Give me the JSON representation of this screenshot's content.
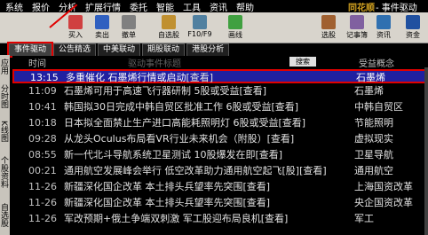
{
  "menu": [
    "系统",
    "报价",
    "分析",
    "扩展行情",
    "委托",
    "智能",
    "工具",
    "资讯",
    "帮助"
  ],
  "brand_logo": "同花顺",
  "window_title": "- 事件驱动",
  "toolbar": {
    "buttons": [
      "买入",
      "卖出",
      "撤单",
      "自选股",
      "F10/F9",
      "画线",
      "选股",
      "记事簿",
      "资讯"
    ],
    "right_label": "资金"
  },
  "tabs": [
    {
      "label": "事件驱动",
      "active": true
    },
    {
      "label": "公告精选",
      "active": false
    },
    {
      "label": "中美联动",
      "active": false
    },
    {
      "label": "期股联动",
      "active": false
    },
    {
      "label": "港股分析",
      "active": false
    }
  ],
  "left_sidebar": [
    "应用",
    "分时图",
    "K线图",
    "个股资料",
    "自选股"
  ],
  "header": {
    "time_col": "时间",
    "subtitle": "驱动事件标题",
    "search_btn": "搜索",
    "concept_col": "受益概念"
  },
  "rows": [
    {
      "time": "13:15",
      "title": "多重催化 石墨烯行情或启动",
      "view": "[查看]",
      "concept": "石墨烯",
      "selected": true
    },
    {
      "time": "11:09",
      "title": "石墨烯可用于高速飞行器研制 5股或受益",
      "view": "[查看]",
      "concept": "石墨烯",
      "selected": false
    },
    {
      "time": "10:41",
      "title": "韩国拟30日完成中韩自贸区批准工作 6股或受益",
      "view": "[查看]",
      "concept": "中韩自贸区",
      "selected": false
    },
    {
      "time": "10:18",
      "title": "日本拟全面禁止生产进口高能耗照明灯 6股或受益",
      "view": "[查看]",
      "concept": "节能照明",
      "selected": false
    },
    {
      "time": "09:28",
      "title": "从龙头Oculus布局看VR行业未来机会（附股）",
      "view": "[查看]",
      "concept": "虚拟现实",
      "selected": false
    },
    {
      "time": "08:55",
      "title": "新一代北斗导航系统卫星测试 10股爆发在即",
      "view": "[查看]",
      "concept": "卫星导航",
      "selected": false
    },
    {
      "time": "00:21",
      "title": "通用航空发展峰会举行 低空改革助力通用航空起飞[股]",
      "view": "[查看]",
      "concept": "通用航空",
      "selected": false
    },
    {
      "time": "11-26",
      "title": "新疆深化国企改革 本土排头兵望率先突围",
      "view": "[查看]",
      "concept": "上海国资改革",
      "selected": false
    },
    {
      "time": "11-26",
      "title": "新疆深化国企改革 本土排头兵望率先突围",
      "view": "[查看]",
      "concept": "央企国资改革",
      "selected": false
    },
    {
      "time": "11-26",
      "title": "军改预期+俄土争端双刺激 军工股迎布局良机",
      "view": "[查看]",
      "concept": "军工",
      "selected": false
    }
  ]
}
